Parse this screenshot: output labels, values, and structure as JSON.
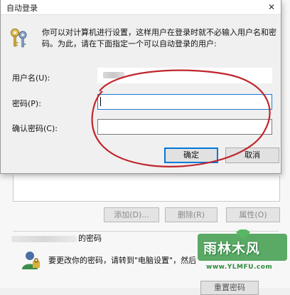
{
  "dialog": {
    "title": "自动登录",
    "close_glyph": "✕",
    "description_line1": "你可以对计算机进行设置，这样用户在登录时就不必输入用户名和密",
    "description_line2": "码。为此，请在下面指定一个可以自动登录的用户:",
    "username_label": "用户名(U):",
    "username_value": "",
    "password_label": "密码(P):",
    "password_value": "",
    "confirm_label": "确认密码(C):",
    "confirm_value": "",
    "ok_label": "确定",
    "cancel_label": "取消"
  },
  "parent": {
    "add_label": "添加(D)...",
    "remove_label": "删除(R)",
    "properties_label": "属性(O)",
    "password_group_caption": "的密码",
    "password_hint": "要更改你的密码，请转到\"电脑设置\"，然后",
    "reset_button_label": "重置密码"
  },
  "watermark": {
    "text": "雨林木风",
    "url": "www.YLMFU.com"
  },
  "icons": {
    "keys": "keys-icon",
    "user": "user-icon",
    "close": "close-icon"
  },
  "colors": {
    "annotation": "#c0262c",
    "focus_border": "#1f78d1",
    "default_button": "#0078d7",
    "watermark_green": "#2f8a3e"
  }
}
